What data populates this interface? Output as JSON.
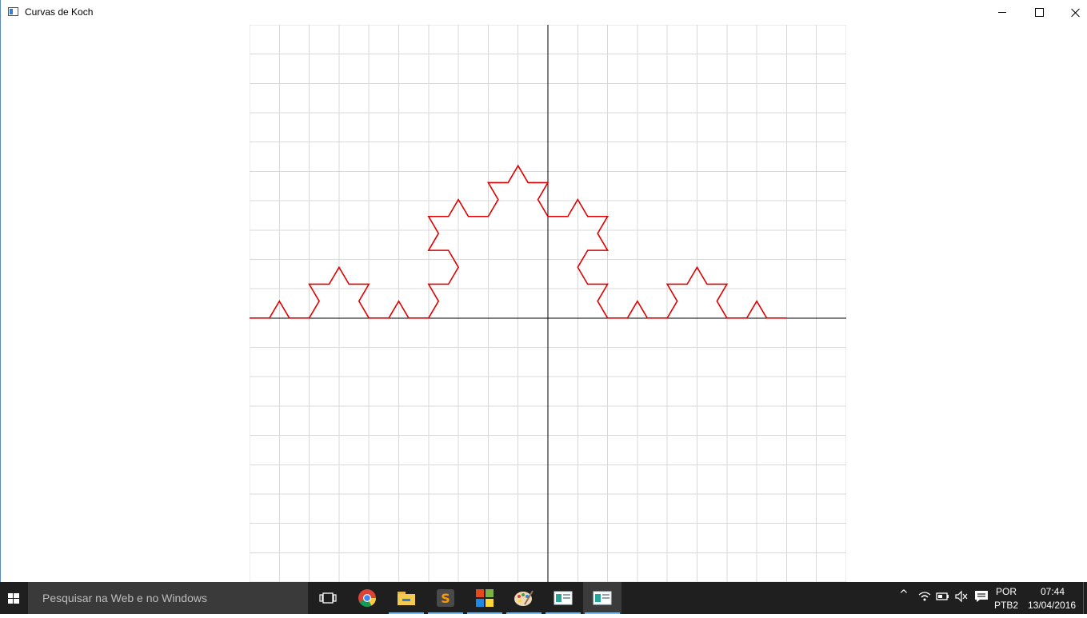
{
  "window": {
    "title": "Curvas de Koch"
  },
  "colors": {
    "curve": "#e00000",
    "grid": "#d9d9d9",
    "axis": "#000000",
    "taskbar": "#1f1f1f",
    "accent": "#76b9ed"
  },
  "plot": {
    "grid": true,
    "curve": "koch",
    "iterations": 3,
    "x_range": [
      -10,
      10
    ],
    "y_range": [
      -9,
      10
    ],
    "curve_from": [
      -10,
      0
    ],
    "curve_to": [
      8,
      0
    ]
  },
  "taskbar": {
    "search_placeholder": "Pesquisar na Web e no Windows",
    "apps": [
      {
        "name": "task-view-icon"
      },
      {
        "name": "chrome-icon"
      },
      {
        "name": "file-explorer-icon"
      },
      {
        "name": "sublime-text-icon"
      },
      {
        "name": "office-icon"
      },
      {
        "name": "paint-icon"
      },
      {
        "name": "app-window-icon"
      },
      {
        "name": "app-window-active-icon"
      }
    ],
    "tray": {
      "language": "POR",
      "keyboard": "PTB2",
      "time": "07:44",
      "date": "13/04/2016"
    }
  }
}
